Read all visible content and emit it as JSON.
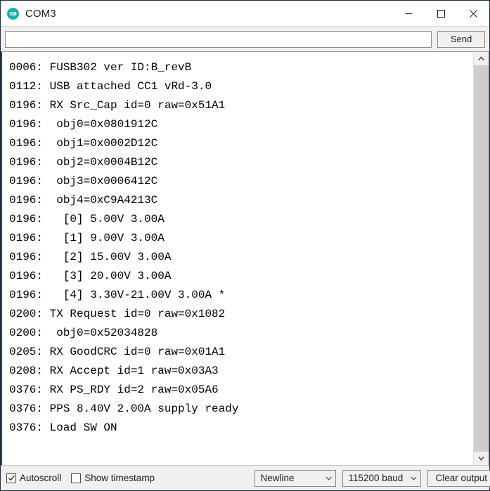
{
  "window": {
    "title": "COM3",
    "app_icon": "arduino-logo-icon",
    "controls": {
      "minimize": "minimize-icon",
      "maximize": "maximize-icon",
      "close": "close-icon"
    }
  },
  "toolbar": {
    "input_value": "",
    "input_placeholder": "",
    "send_label": "Send"
  },
  "log": {
    "lines": [
      "0006: FUSB302 ver ID:B_revB",
      "0112: USB attached CC1 vRd-3.0",
      "0196: RX Src_Cap id=0 raw=0x51A1",
      "0196:  obj0=0x0801912C",
      "0196:  obj1=0x0002D12C",
      "0196:  obj2=0x0004B12C",
      "0196:  obj3=0x0006412C",
      "0196:  obj4=0xC9A4213C",
      "0196:   [0] 5.00V 3.00A",
      "0196:   [1] 9.00V 3.00A",
      "0196:   [2] 15.00V 3.00A",
      "0196:   [3] 20.00V 3.00A",
      "0196:   [4] 3.30V-21.00V 3.00A *",
      "0200: TX Request id=0 raw=0x1082",
      "0200:  obj0=0x52034828",
      "0205: RX GoodCRC id=0 raw=0x01A1",
      "0208: RX Accept id=1 raw=0x03A3",
      "0376: RX PS_RDY id=2 raw=0x05A6",
      "0376: PPS 8.40V 2.00A supply ready",
      "0376: Load SW ON"
    ]
  },
  "scrollbar": {
    "up_arrow": "chevron-up-icon",
    "down_arrow": "chevron-down-icon"
  },
  "statusbar": {
    "autoscroll": {
      "label": "Autoscroll",
      "checked": true
    },
    "show_timestamp": {
      "label": "Show timestamp",
      "checked": false
    },
    "line_ending": {
      "selected": "Newline"
    },
    "baud_rate": {
      "selected": "115200 baud"
    },
    "clear_label": "Clear output"
  },
  "colors": {
    "accent": "#1faeae",
    "window_bg": "#ffffff",
    "chrome_bg": "#f0f0f0",
    "text": "#1c1c1c",
    "log_text": "#000000",
    "scroll_thumb": "#cdcdcd",
    "border": "#2f3f52"
  }
}
